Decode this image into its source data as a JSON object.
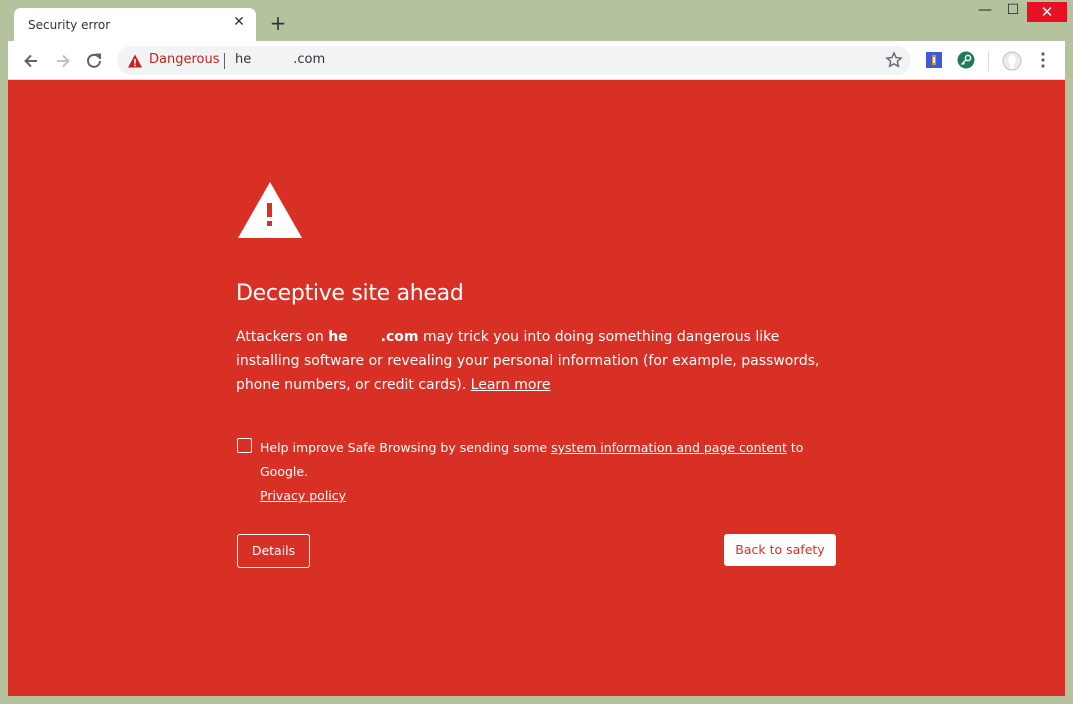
{
  "tab": {
    "title": "Security error",
    "close_icon": "close-icon"
  },
  "window_controls": {
    "minimize": "—",
    "maximize": "☐",
    "close": "✕"
  },
  "omnibox": {
    "security_label": "Dangerous",
    "url_prefix": "he",
    "url_suffix": ".com"
  },
  "interstitial": {
    "heading": "Deceptive site ahead",
    "para_before": "Attackers on ",
    "domain_prefix": "he",
    "domain_suffix": ".com",
    "para_after": " may trick you into doing something dangerous like installing software or revealing your personal information (for example, passwords, phone numbers, or credit cards). ",
    "learn_more": "Learn more",
    "optin_before": "Help improve Safe Browsing by sending some ",
    "optin_link": "system information and page content",
    "optin_after": " to Google.",
    "privacy_policy": "Privacy policy",
    "details_button": "Details",
    "back_button": "Back to safety"
  },
  "colors": {
    "danger_red": "#d93025",
    "frame": "#b5c29e",
    "close_button": "#e81123"
  }
}
